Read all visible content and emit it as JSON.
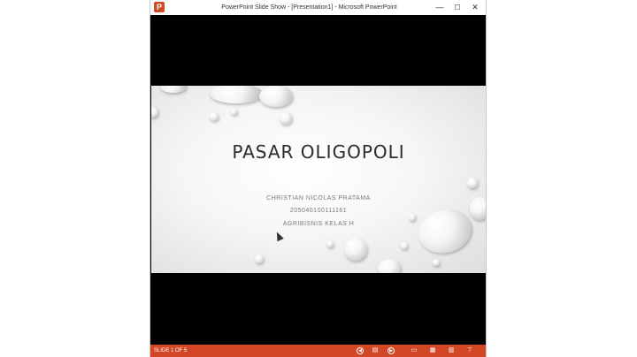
{
  "window": {
    "title": "PowerPoint Slide Show - [Presentation1] - Microsoft PowerPoint",
    "app_icon_letter": "P",
    "controls": {
      "minimize": "—",
      "maximize": "☐",
      "close": "✕"
    }
  },
  "slide": {
    "title": "PASAR OLIGOPOLI",
    "subtitle_lines": [
      "CHRISTIAN NICOLAS PRATAMA",
      "205040100111161",
      "AGRIBISNIS KELAS H"
    ]
  },
  "statusbar": {
    "slide_indicator": "SLIDE 1 OF 5",
    "icons": [
      "previous-icon",
      "menu-icon",
      "next-icon",
      "normal-view-icon",
      "slide-sorter-icon",
      "reading-view-icon",
      "slideshow-icon"
    ]
  },
  "colors": {
    "accent": "#d24726",
    "background": "#000000"
  }
}
